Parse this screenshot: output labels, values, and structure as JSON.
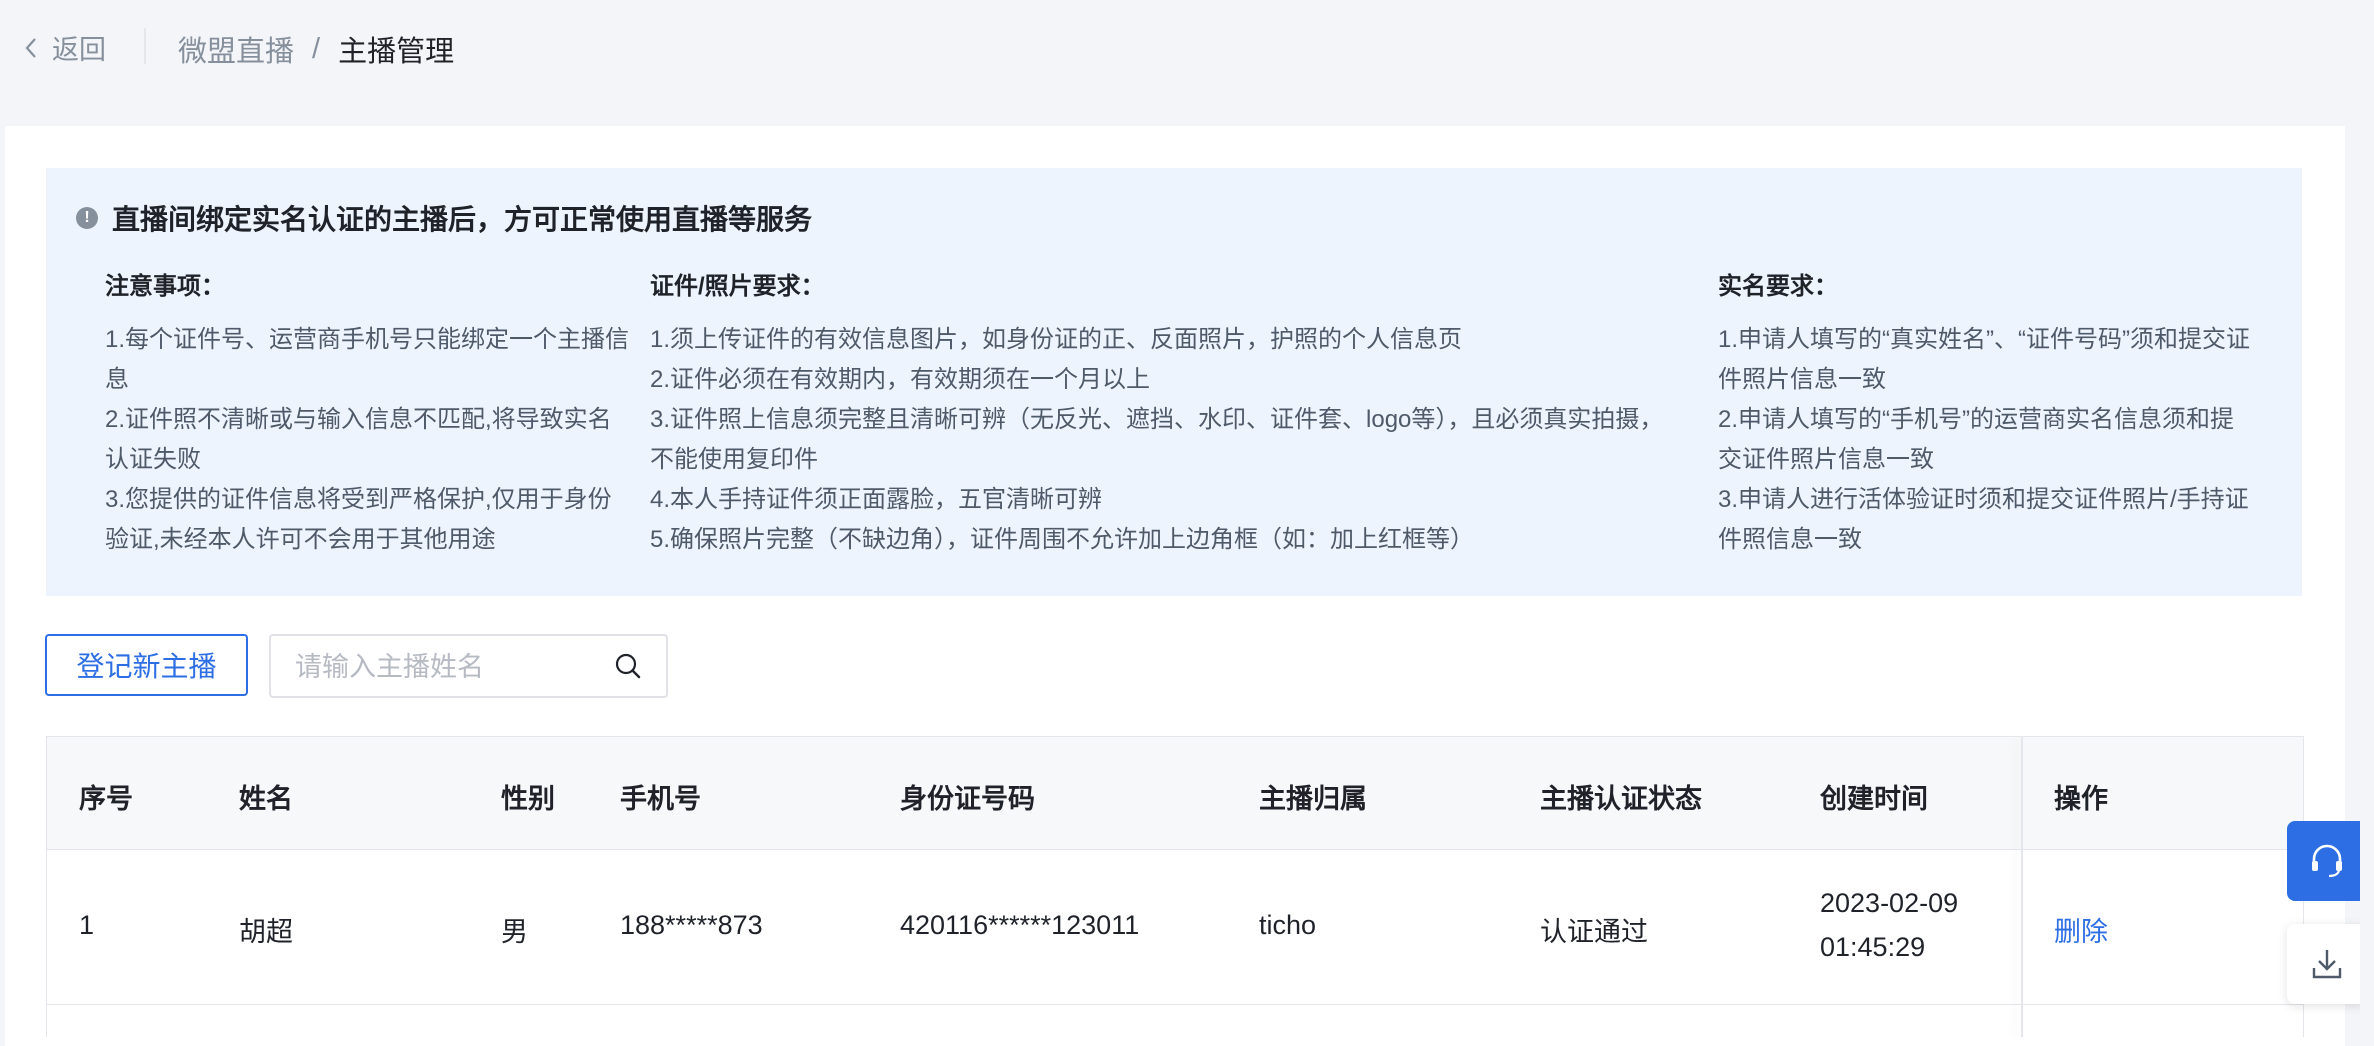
{
  "header": {
    "back_label": "返回",
    "breadcrumb": [
      "微盟直播",
      "/",
      "主播管理"
    ]
  },
  "notice": {
    "title": "直播间绑定实名认证的主播后，方可正常使用直播等服务",
    "columns": [
      {
        "heading": "注意事项：",
        "lines": [
          "1.每个证件号、运营商手机号只能绑定一个主播信息",
          "2.证件照不清晰或与输入信息不匹配,将导致实名认证失败",
          "3.您提供的证件信息将受到严格保护,仅用于身份验证,未经本人许可不会用于其他用途"
        ]
      },
      {
        "heading": "证件/照片要求：",
        "lines": [
          "1.须上传证件的有效信息图片，如身份证的正、反面照片，护照的个人信息页",
          "2.证件必须在有效期内，有效期须在一个月以上",
          "3.证件照上信息须完整且清晰可辨（无反光、遮挡、水印、证件套、logo等），且必须真实拍摄，不能使用复印件",
          "4.本人手持证件须正面露脸，五官清晰可辨",
          "5.确保照片完整（不缺边角），证件周围不允许加上边角框（如：加上红框等）"
        ]
      },
      {
        "heading": "实名要求：",
        "lines": [
          "1.申请人填写的“真实姓名”、“证件号码”须和提交证件照片信息一致",
          "2.申请人填写的“手机号”的运营商实名信息须和提交证件照片信息一致",
          "3.申请人进行活体验证时须和提交证件照片/手持证件照信息一致"
        ]
      }
    ]
  },
  "toolbar": {
    "new_button": "登记新主播",
    "search_placeholder": "请输入主播姓名"
  },
  "table": {
    "headers": [
      "序号",
      "姓名",
      "性别",
      "手机号",
      "身份证号码",
      "主播归属",
      "主播认证状态",
      "创建时间",
      "操作"
    ],
    "rows": [
      {
        "index": "1",
        "name": "胡超",
        "gender": "男",
        "phone": "188*****873",
        "id_number": "420116******123011",
        "owner": "ticho",
        "status": "认证通过",
        "created_date": "2023-02-09",
        "created_time": "01:45:29",
        "action": "删除"
      }
    ]
  },
  "colors": {
    "accent": "#2d6ee4",
    "notice_bg": "#eef4fd",
    "page_bg": "#f4f5f8"
  },
  "icons": [
    "chevron-left-icon",
    "info-icon",
    "search-icon",
    "headset-icon",
    "download-icon"
  ]
}
